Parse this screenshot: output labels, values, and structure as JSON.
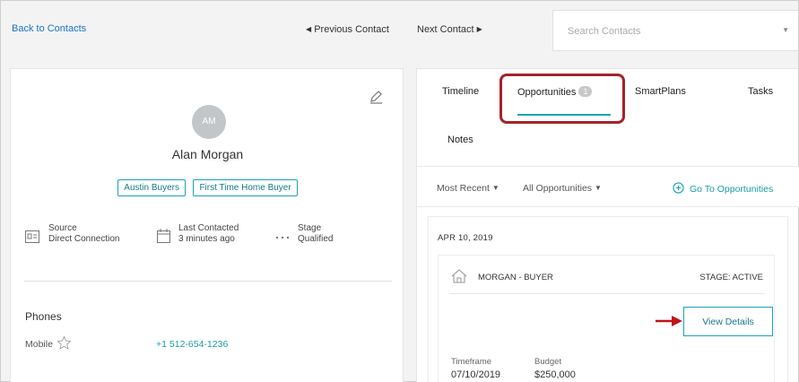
{
  "topbar": {
    "back_label": "Back to Contacts",
    "prev_label": "Previous Contact",
    "next_label": "Next Contact",
    "search_placeholder": "Search Contacts"
  },
  "contact": {
    "initials": "AM",
    "name": "Alan Morgan",
    "tags": [
      "Austin Buyers",
      "First Time Home Buyer"
    ],
    "source_label": "Source",
    "source_value": "Direct Connection",
    "last_contacted_label": "Last Contacted",
    "last_contacted_value": "3 minutes ago",
    "stage_label": "Stage",
    "stage_value": "Qualified",
    "phones_title": "Phones",
    "phone_type": "Mobile",
    "phone_number": "+1 512-654-1236"
  },
  "tabs": {
    "timeline": "Timeline",
    "opportunities": "Opportunities",
    "opportunities_count": "1",
    "smartplans": "SmartPlans",
    "tasks": "Tasks",
    "notes": "Notes"
  },
  "filters": {
    "sort": "Most Recent",
    "scope": "All Opportunities",
    "goto": "Go To Opportunities"
  },
  "opportunity": {
    "date": "APR 10, 2019",
    "name": "MORGAN - BUYER",
    "stage": "STAGE: ACTIVE",
    "view_button": "View Details",
    "timeframe_label": "Timeframe",
    "timeframe_value": "07/10/2019",
    "budget_label": "Budget",
    "budget_value": "$250,000"
  },
  "colors": {
    "accent": "#1aa3b8",
    "link": "#1a73c8",
    "highlight": "#a3232b",
    "arrow": "#c0141c"
  }
}
